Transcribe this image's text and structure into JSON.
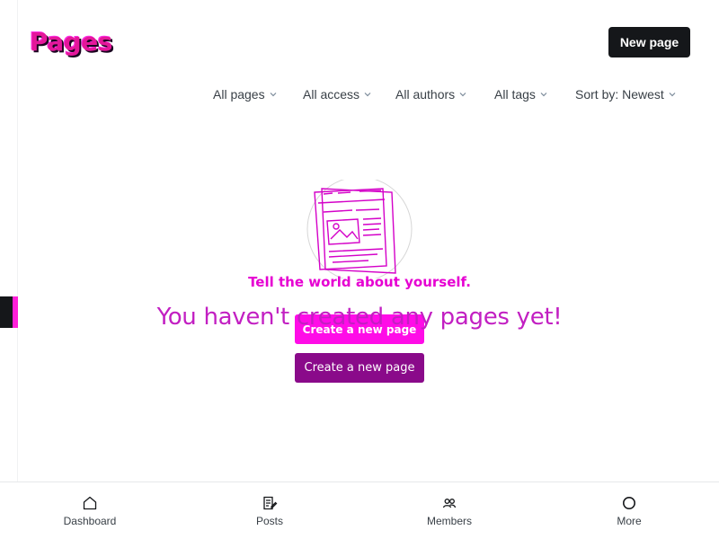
{
  "header": {
    "title": "Pages",
    "new_button_label": "New page"
  },
  "filters": [
    {
      "label": "All pages",
      "icon": "chevron-down-icon"
    },
    {
      "label": "All access",
      "icon": "chevron-down-icon"
    },
    {
      "label": "All authors",
      "icon": "chevron-down-icon"
    },
    {
      "label": "All tags",
      "icon": "chevron-down-icon"
    },
    {
      "label": "Sort by: Newest",
      "icon": "chevron-down-icon"
    }
  ],
  "empty_state": {
    "illustration": "pages-illustration-icon",
    "tagline": "Tell the world about yourself.",
    "heading": "You haven't created any pages yet!",
    "ghost_button_label": "Create a new page",
    "button_label": "Create a new page"
  },
  "bottom_nav": [
    {
      "label": "Dashboard",
      "icon": "home-icon"
    },
    {
      "label": "Posts",
      "icon": "posts-icon"
    },
    {
      "label": "Members",
      "icon": "members-icon"
    },
    {
      "label": "More",
      "icon": "circle-icon"
    }
  ],
  "colors": {
    "title": "#e4179a",
    "accent_magenta": "#ff00e6",
    "primary_button": "#8a0a8a",
    "dark_button": "#15171a",
    "heading": "#c21fc2"
  }
}
